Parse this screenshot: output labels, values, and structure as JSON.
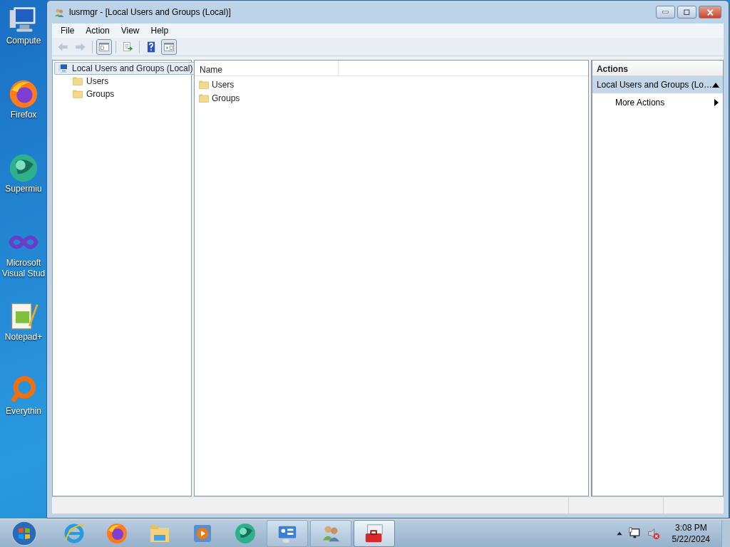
{
  "desktop_icons": [
    {
      "kind": "computer",
      "label": "Compute"
    },
    {
      "kind": "firefox",
      "label": "Firefox"
    },
    {
      "kind": "supermium",
      "label": "Supermiu"
    },
    {
      "kind": "visualstudio",
      "label": "Microsoft Visual Stud"
    },
    {
      "kind": "notepad",
      "label": "Notepad+"
    },
    {
      "kind": "everything",
      "label": "Everythin"
    }
  ],
  "window": {
    "title": "lusrmgr - [Local Users and Groups (Local)]",
    "menu": [
      "File",
      "Action",
      "View",
      "Help"
    ],
    "toolbar": [
      {
        "kind": "back",
        "disabled": true
      },
      {
        "kind": "forward",
        "disabled": true
      },
      {
        "kind": "tree-pane",
        "disabled": false
      },
      {
        "kind": "export",
        "disabled": false
      },
      {
        "kind": "help",
        "disabled": false
      },
      {
        "kind": "action-pane",
        "disabled": false
      }
    ],
    "tree": [
      {
        "label": "Local Users and Groups (Local)",
        "selected": true,
        "children": [
          {
            "label": "Users",
            "selected": false
          },
          {
            "label": "Groups",
            "selected": false
          }
        ]
      }
    ],
    "list": {
      "columns": [
        "Name"
      ],
      "rows": [
        {
          "name": "Users"
        },
        {
          "name": "Groups"
        }
      ]
    },
    "actions": {
      "heading": "Actions",
      "sections": [
        {
          "title": "Local Users and Groups (Lo…",
          "expanded": true,
          "items": [
            "More Actions"
          ]
        }
      ]
    }
  },
  "taskbar": {
    "pinned": [
      {
        "kind": "ie"
      },
      {
        "kind": "firefox"
      },
      {
        "kind": "explorer"
      },
      {
        "kind": "media"
      },
      {
        "kind": "supermium"
      }
    ],
    "windows": [
      {
        "kind": "control-panel",
        "selected": false
      },
      {
        "kind": "users",
        "selected": false
      },
      {
        "kind": "toolbox",
        "selected": true
      }
    ],
    "clock": {
      "time": "3:08 PM",
      "date": "5/22/2024"
    }
  }
}
